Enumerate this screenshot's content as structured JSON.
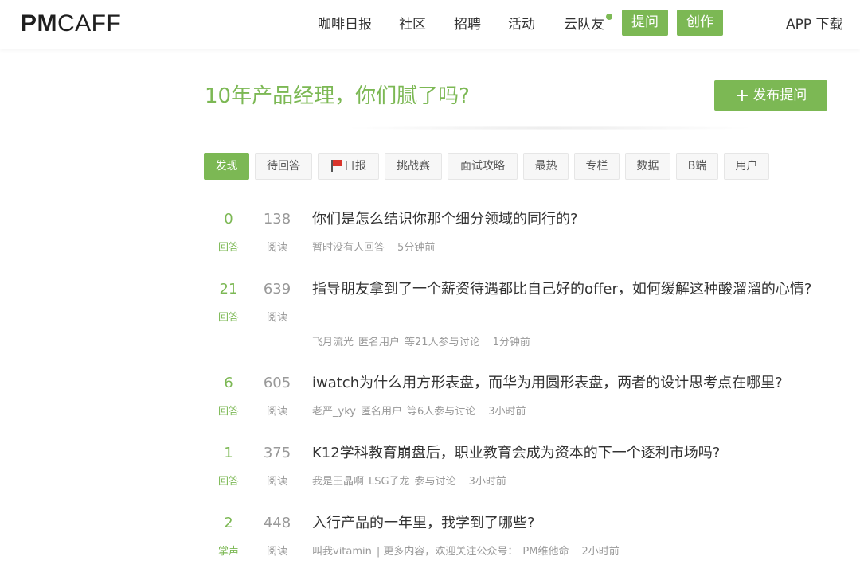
{
  "brand": {
    "logo_bold": "PM",
    "logo_light": "CAFF"
  },
  "nav": {
    "items": [
      "咖啡日报",
      "社区",
      "招聘",
      "活动",
      "云队友"
    ],
    "ask_label": "提问",
    "create_label": "创作",
    "app_download": "APP 下载"
  },
  "hero": {
    "title": "10年产品经理，你们腻了吗?",
    "ask_button": "发布提问",
    "plus": "+"
  },
  "tabs": [
    "发现",
    "待回答",
    "日报",
    "挑战赛",
    "面试攻略",
    "最热",
    "专栏",
    "数据",
    "B端",
    "用户"
  ],
  "colors": {
    "accent": "#7cb854",
    "flag": "#d9342b"
  },
  "questions": [
    {
      "count": "0",
      "count_label": "回答",
      "views": "138",
      "views_label": "阅读",
      "title": "你们是怎么结识你那个细分领域的同行的?",
      "meta": [
        "暂时没有人回答"
      ],
      "time": "5分钟前"
    },
    {
      "count": "21",
      "count_label": "回答",
      "views": "639",
      "views_label": "阅读",
      "title": "指导朋友拿到了一个薪资待遇都比自己好的offer，如何缓解这种酸溜溜的心情?",
      "meta": [
        "飞月流光",
        "匿名用户",
        "等21人参与讨论"
      ],
      "time": "1分钟前"
    },
    {
      "count": "6",
      "count_label": "回答",
      "views": "605",
      "views_label": "阅读",
      "title": "iwatch为什么用方形表盘，而华为用圆形表盘，两者的设计思考点在哪里?",
      "meta": [
        "老严_yky",
        "匿名用户",
        "等6人参与讨论"
      ],
      "time": "3小时前"
    },
    {
      "count": "1",
      "count_label": "回答",
      "views": "375",
      "views_label": "阅读",
      "title": "K12学科教育崩盘后，职业教育会成为资本的下一个逐利市场吗?",
      "meta": [
        "我是王晶啊",
        "LSG子龙",
        "参与讨论"
      ],
      "time": "3小时前"
    },
    {
      "count": "2",
      "count_label": "掌声",
      "views": "448",
      "views_label": "阅读",
      "title": "入行产品的一年里，我学到了哪些?",
      "meta": [
        "叫我vitamin",
        "| 更多内容，欢迎关注公众号：",
        "PM维他命"
      ],
      "time": "2小时前"
    }
  ]
}
